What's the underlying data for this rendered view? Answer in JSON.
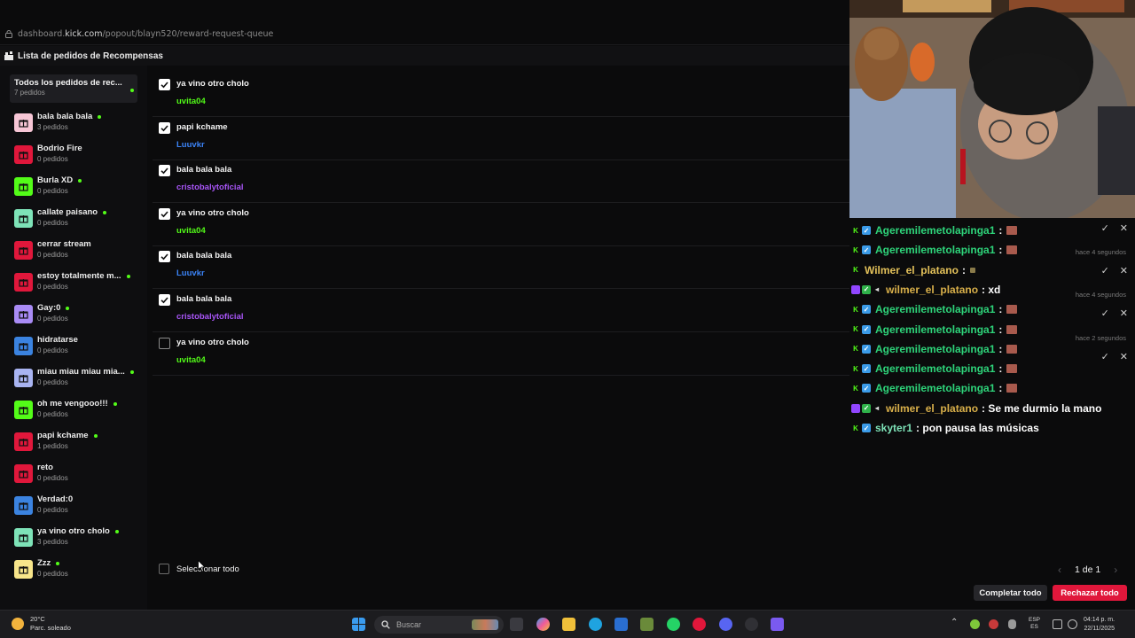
{
  "url": {
    "prefix": "dashboard.",
    "host": "kick.com",
    "path": "/popout/blayn520/reward-request-queue"
  },
  "header": {
    "title": "Lista de pedidos de Recompensas"
  },
  "sidebar": {
    "all": {
      "name": "Todos los pedidos de rec...",
      "count": "7 pedidos"
    },
    "rewards": [
      {
        "name": "bala bala bala",
        "count": "3 pedidos",
        "active": true,
        "color": "#f7c6d6"
      },
      {
        "name": "Bodrio Fire",
        "count": "0 pedidos",
        "active": false,
        "color": "#e0173b"
      },
      {
        "name": "Burla XD",
        "count": "0 pedidos",
        "active": true,
        "color": "#53fc18"
      },
      {
        "name": "callate paisano",
        "count": "0 pedidos",
        "active": true,
        "color": "#7ee3b8"
      },
      {
        "name": "cerrar stream",
        "count": "0 pedidos",
        "active": false,
        "color": "#e0173b"
      },
      {
        "name": "estoy totalmente m...",
        "count": "0 pedidos",
        "active": true,
        "color": "#e0173b"
      },
      {
        "name": "Gay:0",
        "count": "0 pedidos",
        "active": true,
        "color": "#a98bf5"
      },
      {
        "name": "hidratarse",
        "count": "0 pedidos",
        "active": false,
        "color": "#3b83e0"
      },
      {
        "name": "miau miau miau mia...",
        "count": "0 pedidos",
        "active": true,
        "color": "#a9b4f2"
      },
      {
        "name": "oh me vengooo!!!",
        "count": "0 pedidos",
        "active": true,
        "color": "#53fc18"
      },
      {
        "name": "papi kchame",
        "count": "1 pedidos",
        "active": true,
        "color": "#e0173b"
      },
      {
        "name": "reto",
        "count": "0 pedidos",
        "active": false,
        "color": "#e0173b"
      },
      {
        "name": "Verdad:0",
        "count": "0 pedidos",
        "active": false,
        "color": "#3b83e0"
      },
      {
        "name": "ya vino otro cholo",
        "count": "3 pedidos",
        "active": true,
        "color": "#7ee3b8"
      },
      {
        "name": "Zzz",
        "count": "0 pedidos",
        "active": true,
        "color": "#f7e58a"
      }
    ]
  },
  "queue": [
    {
      "title": "ya vino otro cholo",
      "user": "uvita04",
      "user_color": "#53fc18",
      "checked": true
    },
    {
      "title": "papi kchame",
      "user": "Luuvkr",
      "user_color": "#3b83f6",
      "checked": true
    },
    {
      "title": "bala bala bala",
      "user": "cristobalytoficial",
      "user_color": "#a855f7",
      "checked": true
    },
    {
      "title": "ya vino otro cholo",
      "user": "uvita04",
      "user_color": "#53fc18",
      "checked": true
    },
    {
      "title": "bala bala bala",
      "user": "Luuvkr",
      "user_color": "#3b83f6",
      "checked": true
    },
    {
      "title": "bala bala bala",
      "user": "cristobalytoficial",
      "user_color": "#a855f7",
      "checked": true
    },
    {
      "title": "ya vino otro cholo",
      "user": "uvita04",
      "user_color": "#53fc18",
      "checked": false
    }
  ],
  "footer": {
    "select_all": "Seleccionar todo",
    "page": "1 de 1",
    "complete_all": "Completar todo",
    "reject_all": "Rechazar todo"
  },
  "chat": {
    "messages": [
      {
        "user": "Ageremilemetolapinga1",
        "user_color": "#2ed47a",
        "text": ":",
        "emote": true,
        "platform": "kick"
      },
      {
        "user": "Ageremilemetolapinga1",
        "user_color": "#2ed47a",
        "text": ":",
        "emote": true,
        "platform": "kick"
      },
      {
        "user": "Wilmer_el_platano",
        "user_color": "#e3c15a",
        "text": ":",
        "emote": "small",
        "platform": "kick-plain"
      },
      {
        "user": "wilmer_el_platano",
        "user_color": "#d9b04a",
        "text": ": xd",
        "emote": false,
        "platform": "twitch"
      },
      {
        "user": "Ageremilemetolapinga1",
        "user_color": "#2ed47a",
        "text": ":",
        "emote": true,
        "platform": "kick"
      },
      {
        "user": "Ageremilemetolapinga1",
        "user_color": "#2ed47a",
        "text": ":",
        "emote": true,
        "platform": "kick"
      },
      {
        "user": "Ageremilemetolapinga1",
        "user_color": "#2ed47a",
        "text": ":",
        "emote": true,
        "platform": "kick"
      },
      {
        "user": "Ageremilemetolapinga1",
        "user_color": "#2ed47a",
        "text": ":",
        "emote": true,
        "platform": "kick"
      },
      {
        "user": "Ageremilemetolapinga1",
        "user_color": "#2ed47a",
        "text": ":",
        "emote": true,
        "platform": "kick"
      },
      {
        "user": "wilmer_el_platano",
        "user_color": "#d9b04a",
        "text": ": Se me durmio la mano",
        "emote": false,
        "platform": "twitch"
      },
      {
        "user": "skyter1",
        "user_color": "#7ee3b8",
        "text": ": pon pausa las músicas",
        "emote": false,
        "platform": "kick"
      }
    ],
    "ago": [
      "hace 4 segundos",
      "hace 4 segundos",
      "hace 2 segundos"
    ]
  },
  "taskbar": {
    "temp": "20°C",
    "weather": "Parc. soleado",
    "search": "Buscar",
    "lang_top": "ESP",
    "lang_bottom": "ES",
    "time": "04:14 p. m.",
    "date": "22/11/2025"
  }
}
